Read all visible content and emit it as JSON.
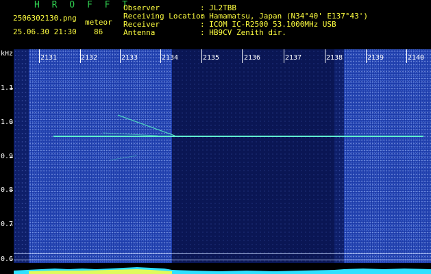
{
  "header": {
    "app_name": "H R O F F T",
    "filename": "2506302130.png",
    "mode": "meteor",
    "datetime": "25.06.30 21:30",
    "count": "86",
    "labels": {
      "observer": "Observer",
      "location": "Receiving Location",
      "receiver": "Receiver",
      "antenna": "Antenna"
    },
    "values": {
      "observer": ": JL2TBB",
      "location": ": Hamamatsu, Japan (N34°40' E137°43')",
      "receiver": ": ICOM IC-R2500 53.1000MHz USB",
      "antenna": ": HB9CV Zenith dir."
    }
  },
  "y_axis": {
    "unit": "kHz",
    "ticks": [
      "1.1",
      "1.0",
      "0.9",
      "0.8",
      "0.7",
      "0.6"
    ]
  },
  "x_axis": {
    "ticks": [
      "2131",
      "2132",
      "2133",
      "2134",
      "2135",
      "2136",
      "2137",
      "2138",
      "2139",
      "2140"
    ]
  },
  "colors": {
    "meteor_trace": "#60ffd0",
    "spectrum_fill": "#30e0ff",
    "spectrum_peaks": "#ffff40"
  }
}
